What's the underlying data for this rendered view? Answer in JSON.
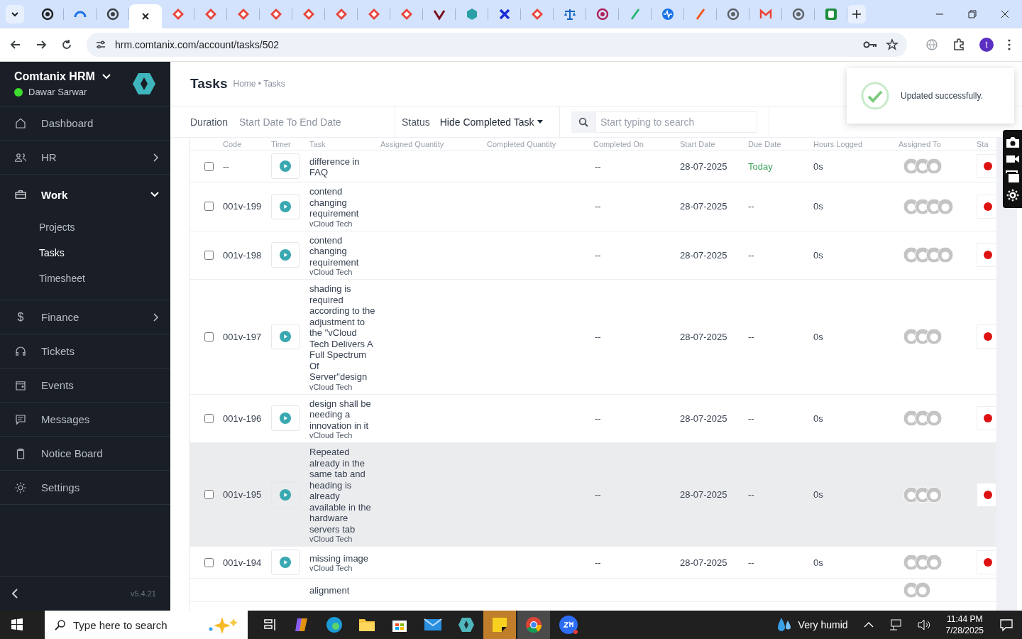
{
  "browser": {
    "tabs": [
      {
        "kind": "circle",
        "color": "#202124",
        "selected": false
      },
      {
        "kind": "arc",
        "color": "#1a73e8",
        "selected": false
      },
      {
        "kind": "circle",
        "color": "#3c4043",
        "selected": false
      },
      {
        "selected": true
      },
      {
        "kind": "diamond",
        "color": "#e8453c",
        "selected": false
      },
      {
        "kind": "diamond",
        "color": "#e8453c",
        "selected": false
      },
      {
        "kind": "diamond",
        "color": "#e8453c",
        "selected": false
      },
      {
        "kind": "diamond",
        "color": "#e8453c",
        "selected": false
      },
      {
        "kind": "diamond",
        "color": "#e8453c",
        "selected": false
      },
      {
        "kind": "diamond",
        "color": "#e8453c",
        "selected": false
      },
      {
        "kind": "diamond",
        "color": "#e8453c",
        "selected": false
      },
      {
        "kind": "diamond",
        "color": "#e8453c",
        "selected": false
      },
      {
        "kind": "check",
        "color": "#7a1020",
        "selected": false
      },
      {
        "kind": "hex",
        "color": "#2a9fa8",
        "selected": false
      },
      {
        "kind": "cross",
        "color": "#1a2bd8",
        "selected": false
      },
      {
        "kind": "diamond",
        "color": "#e8453c",
        "selected": false
      },
      {
        "kind": "scale",
        "color": "#1565c0",
        "selected": false
      },
      {
        "kind": "circle",
        "color": "#b0245a",
        "selected": false
      },
      {
        "kind": "slash",
        "color": "#2bb673",
        "selected": false
      },
      {
        "kind": "pulse",
        "color": "#1a73e8",
        "selected": false
      },
      {
        "kind": "slash",
        "color": "#f2541b",
        "selected": false
      },
      {
        "kind": "circle",
        "color": "#5f6368",
        "selected": false
      },
      {
        "kind": "mail",
        "color": "#ea4335",
        "selected": false
      },
      {
        "kind": "circle",
        "color": "#5f6368",
        "selected": false
      },
      {
        "kind": "square",
        "color": "#1e8e3e",
        "selected": false
      }
    ],
    "url": "hrm.comtanix.com/account/tasks/502",
    "profile": "t"
  },
  "sidebar": {
    "brand": "Comtanix HRM",
    "user": "Dawar Sarwar",
    "online": true,
    "items": [
      {
        "label": "Dashboard",
        "selected": false
      },
      {
        "label": "HR",
        "expanded": false,
        "selected": false
      },
      {
        "label": "Work",
        "expanded": true,
        "selected": true,
        "children": [
          {
            "label": "Projects",
            "selected": false
          },
          {
            "label": "Tasks",
            "selected": true
          },
          {
            "label": "Timesheet",
            "selected": false
          }
        ]
      },
      {
        "label": "Finance",
        "glyph": "$",
        "expanded": false,
        "selected": false
      },
      {
        "label": "Tickets",
        "selected": false
      },
      {
        "label": "Events",
        "selected": false
      },
      {
        "label": "Messages",
        "selected": false
      },
      {
        "label": "Notice Board",
        "selected": false
      },
      {
        "label": "Settings",
        "selected": false
      }
    ],
    "version": "v5.4.21"
  },
  "header": {
    "title": "Tasks",
    "breadcrumb": "Home • Tasks"
  },
  "filters": {
    "duration_label": "Duration",
    "duration_placeholder": "Start Date To End Date",
    "status_label": "Status",
    "status_value": "Hide Completed Task",
    "search_placeholder": "Start typing to search"
  },
  "table": {
    "columns": [
      "",
      "Code",
      "Timer",
      "Task",
      "Assigned Quantity",
      "Completed Quantity",
      "Completed On",
      "Start Date",
      "Due Date",
      "Hours Logged",
      "Assigned To",
      "Sta"
    ],
    "rows": [
      {
        "checked": false,
        "code": "--",
        "task": "difference in FAQ",
        "completed_on": "--",
        "start_date": "28-07-2025",
        "due_date": "Today",
        "due_highlighted": true,
        "hours": "0s",
        "assignees": [
          {
            "kind": "avatar"
          },
          {
            "kind": "avatar"
          },
          {
            "kind": "avatar"
          }
        ],
        "color": "#dd1111",
        "highlighted": false
      },
      {
        "checked": false,
        "code": "001v-199",
        "task": "contend changing requirement",
        "project": "vCloud Tech",
        "completed_on": "--",
        "start_date": "28-07-2025",
        "due_date": "--",
        "due_highlighted": false,
        "hours": "0s",
        "assignees": [
          {
            "kind": "avatar"
          },
          {
            "kind": "avatar"
          },
          {
            "kind": "avatar"
          },
          {
            "kind": "avatar"
          }
        ],
        "color": "#dd1111",
        "highlighted": false
      },
      {
        "checked": false,
        "code": "001v-198",
        "task": "contend changing requirement",
        "project": "vCloud Tech",
        "completed_on": "--",
        "start_date": "28-07-2025",
        "due_date": "--",
        "due_highlighted": false,
        "hours": "0s",
        "assignees": [
          {
            "kind": "avatar"
          },
          {
            "kind": "avatar"
          },
          {
            "kind": "avatar"
          },
          {
            "kind": "avatar"
          }
        ],
        "color": "#dd1111",
        "highlighted": false
      },
      {
        "checked": false,
        "code": "001v-197",
        "task": "shading is required according to the adjustment to the \"vCloud Tech Delivers A Full Spectrum Of Server\"design",
        "project": "vCloud Tech",
        "completed_on": "--",
        "start_date": "28-07-2025",
        "due_date": "--",
        "due_highlighted": false,
        "hours": "0s",
        "assignees": [
          {
            "kind": "avatar"
          },
          {
            "kind": "avatar"
          },
          {
            "kind": "avatar"
          }
        ],
        "color": "#dd1111",
        "highlighted": false
      },
      {
        "checked": false,
        "code": "001v-196",
        "task": "design shall be needing a innovation in it",
        "project": "vCloud Tech",
        "completed_on": "--",
        "start_date": "28-07-2025",
        "due_date": "--",
        "due_highlighted": false,
        "hours": "0s",
        "assignees": [
          {
            "kind": "avatar"
          },
          {
            "kind": "avatar"
          },
          {
            "kind": "avatar"
          }
        ],
        "color": "#dd1111",
        "highlighted": false
      },
      {
        "checked": false,
        "code": "001v-195",
        "task": "Repeated already in the same tab and heading is already available in the hardware servers tab",
        "project": "vCloud Tech",
        "completed_on": "--",
        "start_date": "28-07-2025",
        "due_date": "--",
        "due_highlighted": false,
        "hours": "0s",
        "assignees": [
          {
            "kind": "avatar"
          },
          {
            "kind": "avatar"
          },
          {
            "kind": "avatar"
          }
        ],
        "color": "#dd1111",
        "highlighted": true
      },
      {
        "checked": false,
        "code": "001v-194",
        "task": "missing image",
        "project": "vCloud Tech",
        "completed_on": "--",
        "start_date": "28-07-2025",
        "due_date": "--",
        "due_highlighted": false,
        "hours": "0s",
        "assignees": [
          {
            "kind": "avatar"
          },
          {
            "kind": "avatar"
          },
          {
            "kind": "avatar"
          }
        ],
        "color": "#dd1111",
        "highlighted": false
      },
      {
        "task": "alignment",
        "assignees": [
          {
            "kind": "avatar"
          },
          {
            "kind": "avatar"
          }
        ],
        "highlighted": false
      }
    ]
  },
  "toast": {
    "message": "Updated successfully."
  },
  "taskbar": {
    "search_placeholder": "Type here to search",
    "weather": "Very humid",
    "time": "11:44 PM",
    "date": "7/28/2025"
  }
}
